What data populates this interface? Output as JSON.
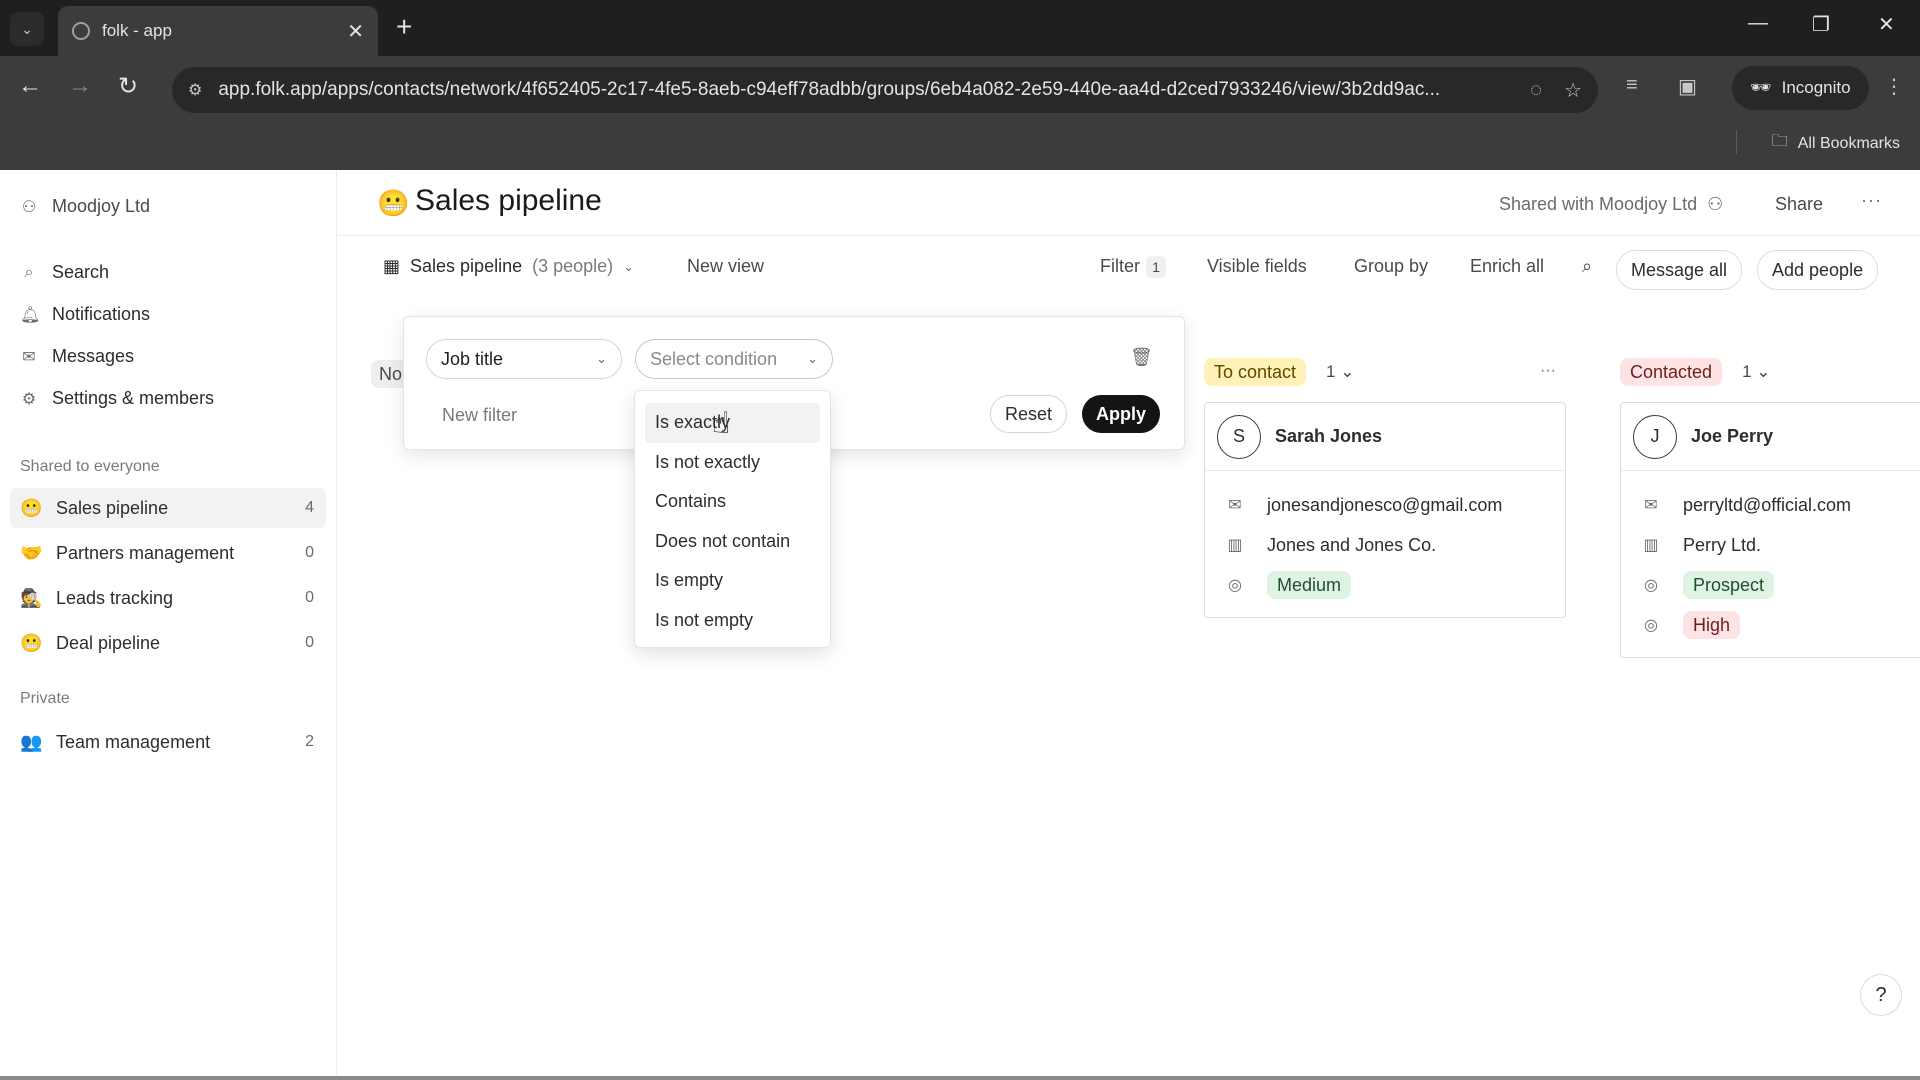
{
  "browser": {
    "tab_title": "folk - app",
    "url": "app.folk.app/apps/contacts/network/4f652405-2c17-4fe5-8aeb-c94eff78adbb/groups/6eb4a082-2e59-440e-aa4d-d2ced7933246/view/3b2dd9ac...",
    "incognito_label": "Incognito",
    "bookmarks_label": "All Bookmarks"
  },
  "sidebar": {
    "workspace": "Moodjoy Ltd",
    "nav": [
      {
        "label": "Search",
        "icon": "search-icon"
      },
      {
        "label": "Notifications",
        "icon": "bell-icon"
      },
      {
        "label": "Messages",
        "icon": "mail-icon"
      },
      {
        "label": "Settings & members",
        "icon": "gear-icon"
      }
    ],
    "shared_section": "Shared to everyone",
    "shared_groups": [
      {
        "label": "Sales pipeline",
        "count": "4",
        "emoji": "😬"
      },
      {
        "label": "Partners management",
        "count": "0",
        "emoji": "🤝"
      },
      {
        "label": "Leads tracking",
        "count": "0",
        "emoji": "🕵"
      },
      {
        "label": "Deal pipeline",
        "count": "0",
        "emoji": "😬"
      }
    ],
    "private_section": "Private",
    "private_groups": [
      {
        "label": "Team management",
        "count": "2",
        "emoji": "👥"
      }
    ]
  },
  "header": {
    "emoji": "😬",
    "title": "Sales pipeline",
    "shared_with": "Shared with Moodjoy Ltd",
    "share": "Share",
    "more": "···"
  },
  "viewbar": {
    "view_name": "Sales pipeline",
    "view_count": "(3 people)",
    "new_view": "New view",
    "filter": "Filter",
    "filter_count": "1",
    "visible_fields": "Visible fields",
    "group_by": "Group by",
    "enrich_all": "Enrich all",
    "message_all": "Message all",
    "add_people": "Add people"
  },
  "board": {
    "hidden_col_label": "No",
    "columns": [
      {
        "status": "To contact",
        "count": "1",
        "status_bg": "#fff1b8",
        "status_fg": "#5a4a00",
        "card": {
          "initial": "S",
          "name": "Sarah Jones",
          "email": "jonesandjonesco@gmail.com",
          "company": "Jones and Jones Co.",
          "tags": [
            "Medium"
          ]
        }
      },
      {
        "status": "Contacted",
        "count": "1",
        "status_bg": "#fde3e3",
        "status_fg": "#6b1f1f",
        "card": {
          "initial": "J",
          "name": "Joe Perry",
          "email": "perryltd@official.com",
          "company": "Perry Ltd.",
          "tags": [
            "Prospect",
            "High"
          ]
        }
      }
    ]
  },
  "filter_panel": {
    "field": "Job title",
    "condition_placeholder": "Select condition",
    "new_filter": "New filter",
    "reset": "Reset",
    "apply": "Apply",
    "conditions": [
      "Is exactly",
      "Is not exactly",
      "Contains",
      "Does not contain",
      "Is empty",
      "Is not empty"
    ]
  },
  "help": "?"
}
